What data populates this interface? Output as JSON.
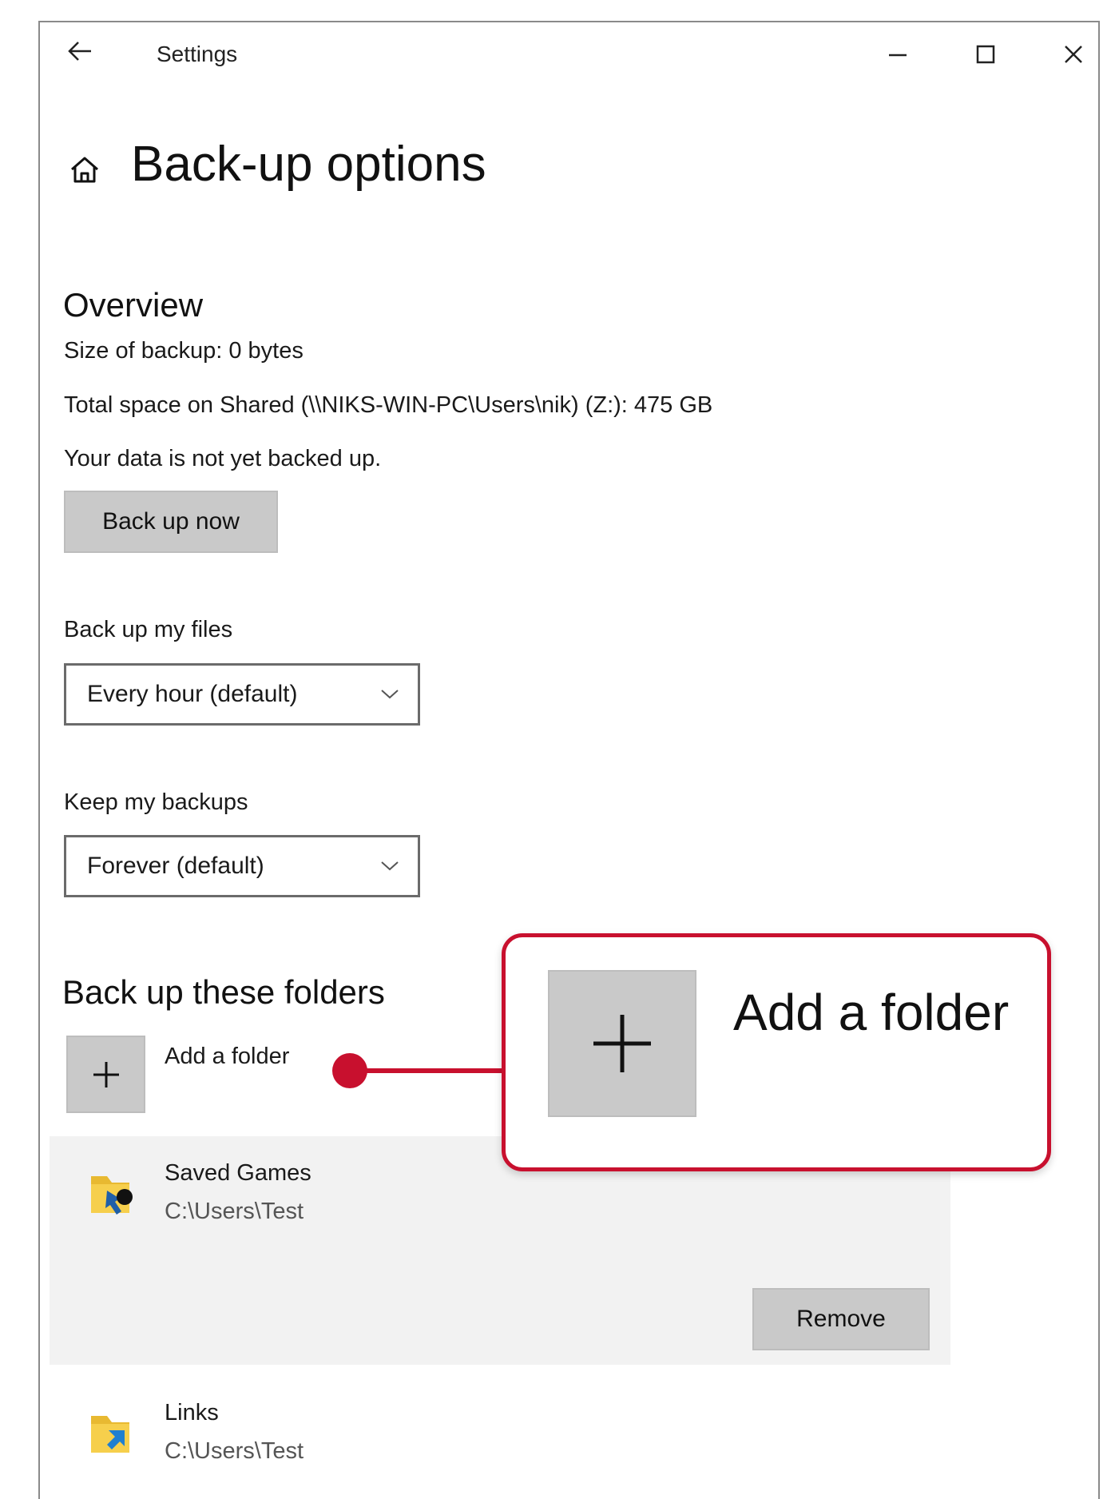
{
  "titlebar": {
    "back_icon": "arrow-left-icon",
    "title": "Settings",
    "minimize_icon": "minimize-icon",
    "maximize_icon": "maximize-icon",
    "close_icon": "close-icon"
  },
  "page": {
    "home_icon": "home-icon",
    "title": "Back-up options"
  },
  "overview": {
    "heading": "Overview",
    "size_text": "Size of backup: 0 bytes",
    "space_text": "Total space on Shared (\\\\NIKS-WIN-PC\\Users\\nik) (Z:): 475 GB",
    "status_text": "Your data is not yet backed up.",
    "backup_now_label": "Back up now"
  },
  "frequency": {
    "label": "Back up my files",
    "selected": "Every hour (default)"
  },
  "retention": {
    "label": "Keep my backups",
    "selected": "Forever (default)"
  },
  "folders": {
    "heading": "Back up these folders",
    "add_label": "Add a folder",
    "items": [
      {
        "name": "Saved Games",
        "path": "C:\\Users\\Test",
        "icon": "folder-icon",
        "remove_label": "Remove"
      },
      {
        "name": "Links",
        "path": "C:\\Users\\Test",
        "icon": "folder-icon"
      }
    ]
  },
  "callout": {
    "label": "Add a folder",
    "accent_color": "#c8102e"
  }
}
